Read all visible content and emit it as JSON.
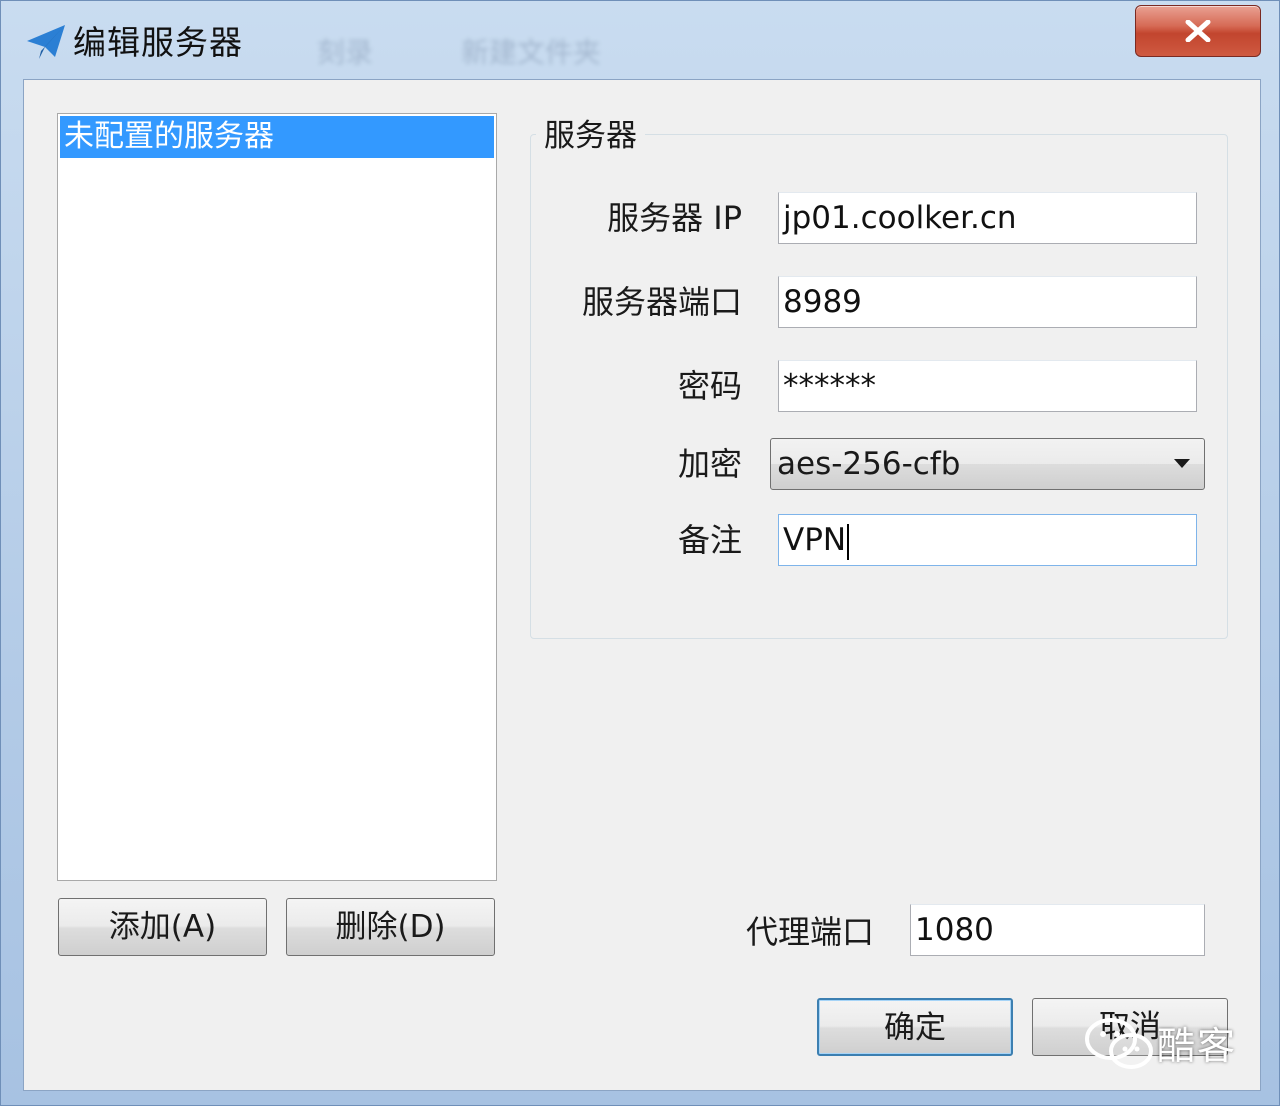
{
  "window": {
    "title": "编辑服务器",
    "background_tabs": [
      "刻录",
      "新建文件夹"
    ],
    "close_label": "x"
  },
  "server_list": {
    "items": [
      {
        "label": "未配置的服务器",
        "selected": true
      }
    ]
  },
  "list_buttons": {
    "add_label": "添加(A)",
    "delete_label": "删除(D)"
  },
  "server_group": {
    "title": "服务器",
    "ip_label": "服务器 IP",
    "ip_value": "jp01.coolker.cn",
    "port_label": "服务器端口",
    "port_value": "8989",
    "password_label": "密码",
    "password_value": "******",
    "encryption_label": "加密",
    "encryption_value": "aes-256-cfb",
    "remark_label": "备注",
    "remark_value": "VPN"
  },
  "proxy": {
    "label": "代理端口",
    "value": "1080"
  },
  "dialog_buttons": {
    "ok_label": "确定",
    "cancel_label": "取消"
  },
  "watermark": {
    "text": "酷客"
  },
  "colors": {
    "selection": "#3399ff",
    "close_button": "#c7462f",
    "titlebar": "#b8cfe9"
  }
}
